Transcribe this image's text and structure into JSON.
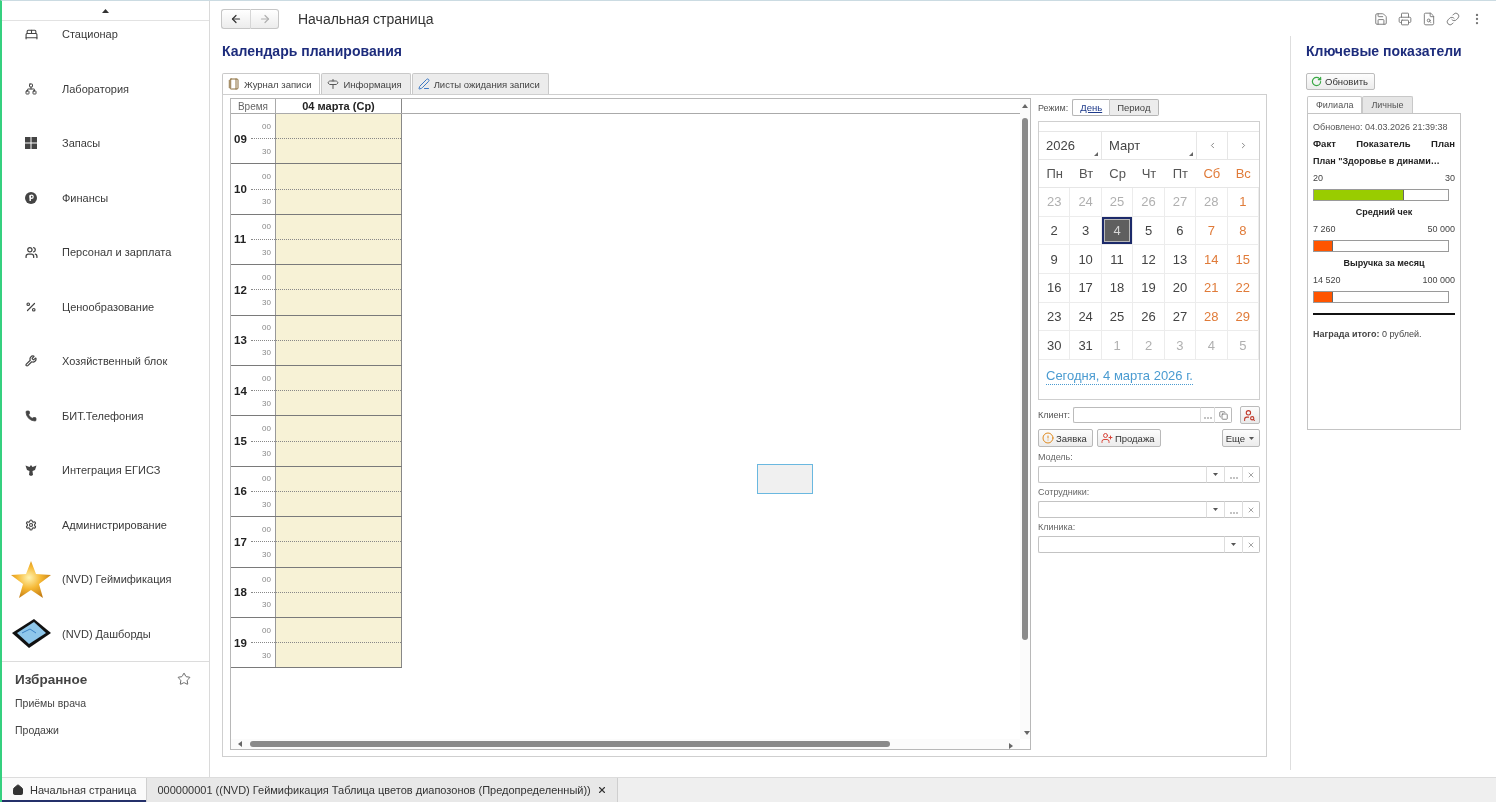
{
  "sidebar": {
    "items": [
      {
        "label": "Стационар"
      },
      {
        "label": "Лаборатория"
      },
      {
        "label": "Запасы"
      },
      {
        "label": "Финансы"
      },
      {
        "label": "Персонал и зарплата"
      },
      {
        "label": "Ценообразование"
      },
      {
        "label": "Хозяйственный блок"
      },
      {
        "label": "БИТ.Телефония"
      },
      {
        "label": "Интеграция ЕГИСЗ"
      },
      {
        "label": "Администрирование"
      },
      {
        "label": "(NVD) Геймификация"
      },
      {
        "label": "(NVD) Дашборды"
      }
    ],
    "favorites": {
      "title": "Избранное",
      "items": [
        {
          "label": "Приёмы врача"
        },
        {
          "label": "Продажи"
        }
      ]
    }
  },
  "header": {
    "navigation": {
      "back": {
        "disabled": false
      },
      "forward": {
        "disabled": true
      }
    },
    "title": "Начальная страница"
  },
  "planner": {
    "title": "Календарь планирования",
    "tabs": [
      {
        "label": "Журнал записи",
        "selected": true
      },
      {
        "label": "Информация",
        "selected": false
      },
      {
        "label": "Листы ожидания записи",
        "selected": false
      }
    ],
    "schedule": {
      "time_header": "Время",
      "day_header": "04 марта (Ср)",
      "hours": [
        {
          "hour": "09",
          "minutes": [
            "00",
            "30"
          ]
        },
        {
          "hour": "10",
          "minutes": [
            "00",
            "30"
          ]
        },
        {
          "hour": "11",
          "minutes": [
            "00",
            "30"
          ]
        },
        {
          "hour": "12",
          "minutes": [
            "00",
            "30"
          ]
        },
        {
          "hour": "13",
          "minutes": [
            "00",
            "30"
          ]
        },
        {
          "hour": "14",
          "minutes": [
            "00",
            "30"
          ]
        },
        {
          "hour": "15",
          "minutes": [
            "00",
            "30"
          ]
        },
        {
          "hour": "16",
          "minutes": [
            "00",
            "30"
          ]
        },
        {
          "hour": "17",
          "minutes": [
            "00",
            "30"
          ]
        },
        {
          "hour": "18",
          "minutes": [
            "00",
            "30"
          ]
        },
        {
          "hour": "19",
          "minutes": [
            "00",
            "30"
          ]
        }
      ]
    },
    "mode": {
      "label": "Режим:",
      "options": [
        {
          "label": "День",
          "selected": true
        },
        {
          "label": "Период",
          "selected": false
        }
      ]
    },
    "calendar": {
      "year": "2026",
      "month": "Март",
      "weekdays": [
        {
          "label": "Пн",
          "weekend": false
        },
        {
          "label": "Вт",
          "weekend": false
        },
        {
          "label": "Ср",
          "weekend": false
        },
        {
          "label": "Чт",
          "weekend": false
        },
        {
          "label": "Пт",
          "weekend": false
        },
        {
          "label": "Сб",
          "weekend": true
        },
        {
          "label": "Вс",
          "weekend": true
        }
      ],
      "weeks": [
        {
          "days": [
            {
              "day": "23",
              "outside": true,
              "selected": false
            },
            {
              "day": "24",
              "outside": true,
              "selected": false
            },
            {
              "day": "25",
              "outside": true,
              "selected": false
            },
            {
              "day": "26",
              "outside": true,
              "selected": false
            },
            {
              "day": "27",
              "outside": true,
              "selected": false
            },
            {
              "day": "28",
              "outside": true,
              "selected": false
            },
            {
              "day": "1",
              "outside": false,
              "selected": false
            }
          ]
        },
        {
          "days": [
            {
              "day": "2",
              "outside": false,
              "selected": false
            },
            {
              "day": "3",
              "outside": false,
              "selected": false
            },
            {
              "day": "4",
              "outside": false,
              "selected": true
            },
            {
              "day": "5",
              "outside": false,
              "selected": false
            },
            {
              "day": "6",
              "outside": false,
              "selected": false
            },
            {
              "day": "7",
              "outside": false,
              "selected": false
            },
            {
              "day": "8",
              "outside": false,
              "selected": false
            }
          ]
        },
        {
          "days": [
            {
              "day": "9",
              "outside": false,
              "selected": false
            },
            {
              "day": "10",
              "outside": false,
              "selected": false
            },
            {
              "day": "11",
              "outside": false,
              "selected": false
            },
            {
              "day": "12",
              "outside": false,
              "selected": false
            },
            {
              "day": "13",
              "outside": false,
              "selected": false
            },
            {
              "day": "14",
              "outside": false,
              "selected": false
            },
            {
              "day": "15",
              "outside": false,
              "selected": false
            }
          ]
        },
        {
          "days": [
            {
              "day": "16",
              "outside": false,
              "selected": false
            },
            {
              "day": "17",
              "outside": false,
              "selected": false
            },
            {
              "day": "18",
              "outside": false,
              "selected": false
            },
            {
              "day": "19",
              "outside": false,
              "selected": false
            },
            {
              "day": "20",
              "outside": false,
              "selected": false
            },
            {
              "day": "21",
              "outside": false,
              "selected": false
            },
            {
              "day": "22",
              "outside": false,
              "selected": false
            }
          ]
        },
        {
          "days": [
            {
              "day": "23",
              "outside": false,
              "selected": false
            },
            {
              "day": "24",
              "outside": false,
              "selected": false
            },
            {
              "day": "25",
              "outside": false,
              "selected": false
            },
            {
              "day": "26",
              "outside": false,
              "selected": false
            },
            {
              "day": "27",
              "outside": false,
              "selected": false
            },
            {
              "day": "28",
              "outside": false,
              "selected": false
            },
            {
              "day": "29",
              "outside": false,
              "selected": false
            }
          ]
        },
        {
          "days": [
            {
              "day": "30",
              "outside": false,
              "selected": false
            },
            {
              "day": "31",
              "outside": false,
              "selected": false
            },
            {
              "day": "1",
              "outside": true,
              "selected": false
            },
            {
              "day": "2",
              "outside": true,
              "selected": false
            },
            {
              "day": "3",
              "outside": true,
              "selected": false
            },
            {
              "day": "4",
              "outside": true,
              "selected": false
            },
            {
              "day": "5",
              "outside": true,
              "selected": false
            }
          ]
        }
      ],
      "today_link": "Сегодня, 4 марта 2026 г."
    },
    "client": {
      "label": "Клиент:"
    },
    "actions": [
      {
        "label": "Заявка",
        "kind": "request"
      },
      {
        "label": "Продажа",
        "kind": "sale"
      }
    ],
    "more_button": "Еще",
    "filters": [
      {
        "label": "Модель:",
        "kind": "full"
      },
      {
        "label": "Сотрудники:",
        "kind": "full"
      },
      {
        "label": "Клиника:",
        "kind": "short"
      }
    ]
  },
  "indicators": {
    "title": "Ключевые показатели",
    "refresh_button": "Обновить",
    "tabs": [
      {
        "label": "Филиала",
        "selected": true
      },
      {
        "label": "Личные",
        "selected": false
      }
    ],
    "updated": "Обновлено: 04.03.2026 21:39:38",
    "columns": [
      "Факт",
      "Показатель",
      "План"
    ],
    "metrics": [
      {
        "kind": "plan",
        "title": "План \"Здоровье в динами…",
        "fact": "20",
        "plan": "30",
        "level": 0.67,
        "color": "#99cc00"
      },
      {
        "kind": "metric",
        "title": "Средний чек",
        "fact": "7 260",
        "plan": "50 000",
        "level": 0.145,
        "color": "#ff5500"
      },
      {
        "kind": "metric",
        "title": "Выручка за месяц",
        "fact": "14 520",
        "plan": "100 000",
        "level": 0.145,
        "color": "#ff5500"
      }
    ],
    "total": "**Награда итого:** 0 рублей."
  },
  "taskbar": {
    "tabs": [
      {
        "kind": "home",
        "label": "Начальная страница",
        "selected": true,
        "closable": false
      },
      {
        "kind": "document",
        "label": "000000001 ((NVD) Геймификация Таблица цветов диапозонов (Предопределенный))",
        "selected": false,
        "closable": true
      }
    ]
  }
}
